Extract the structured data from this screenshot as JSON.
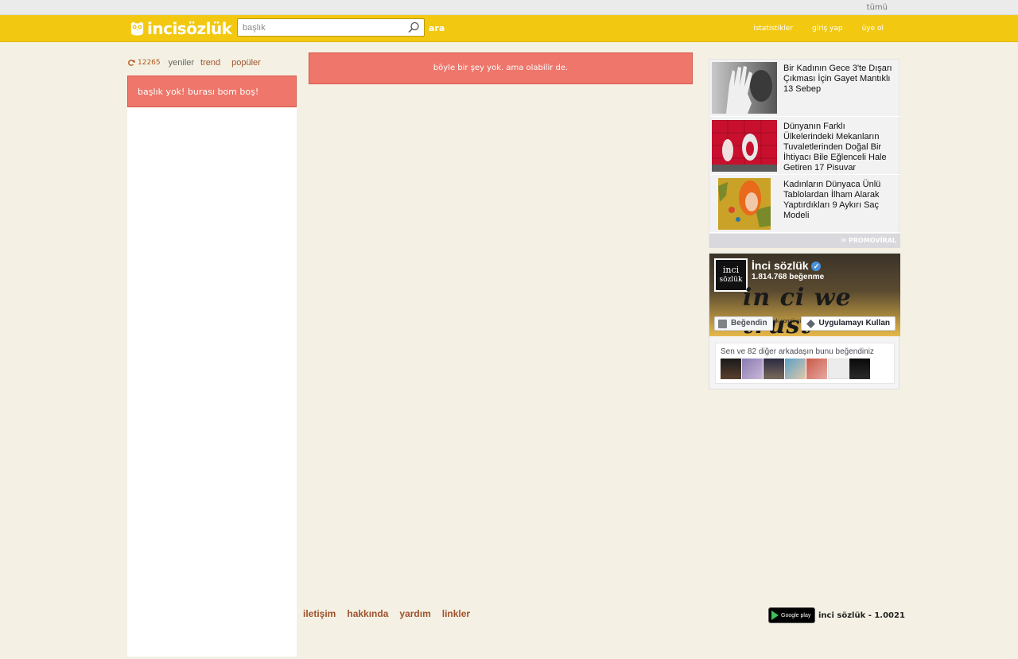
{
  "topbar": {
    "filter_label": "tümü"
  },
  "header": {
    "logo_text": "incisözlük",
    "search_placeholder": "başlık",
    "search_button": "ara",
    "nav": [
      {
        "label": "istatistikler"
      },
      {
        "label": "giriş yap"
      },
      {
        "label": "üye ol"
      }
    ]
  },
  "left": {
    "count": "12265",
    "tabs": {
      "new": "yeniler",
      "trend": "trend",
      "popular": "popüler"
    },
    "empty_message": "başlık yok! burası bom boş!"
  },
  "main": {
    "alert": "böyle bir şey yok. ama olabilir de."
  },
  "ads": {
    "items": [
      {
        "title": "Bir Kadının Gece 3'te Dışarı Çıkması İçin Gayet Mantıklı 13 Sebep"
      },
      {
        "title": "Dünyanın Farklı Ülkelerindeki Mekanların Tuvaletlerinden Doğal Bir İhtiyacı Bile Eğlenceli Hale Getiren 17 Pisuvar"
      },
      {
        "title": "Kadınların Dünyaca Ünlü Tablolardan İlham Alarak Yaptırdıkları 9 Aykırı Saç Modeli"
      }
    ],
    "brand": "PROMOVİRAL"
  },
  "facebook": {
    "page_name": "İnci sözlük",
    "likes": "1.814.768 beğenme",
    "slogan": "in ci we trust",
    "url_fragment": "ok.com/incisozluk",
    "liked_button": "Beğendin",
    "app_button": "Uygulamayı Kullan",
    "friends_text": "Sen ve 82 diğer arkadaşın bunu beğendiniz",
    "logo_text_1": "inci",
    "logo_text_2": "sözlük"
  },
  "footer": {
    "links": [
      {
        "label": "iletişim"
      },
      {
        "label": "hakkında"
      },
      {
        "label": "yardım"
      },
      {
        "label": "linkler"
      }
    ],
    "version": "inci sözlük - 1.0021",
    "store_label": "Google play"
  },
  "colors": {
    "header": "#f2c811",
    "background": "#f4f1e4",
    "alert": "#ee766a",
    "link": "#a0522d"
  }
}
